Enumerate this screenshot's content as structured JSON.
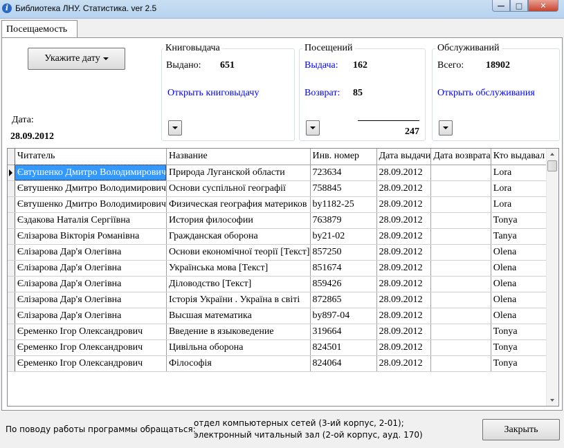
{
  "window": {
    "title": "Библиотека ЛНУ. Статистика. ver 2.5",
    "icon": "info-icon"
  },
  "tab": {
    "label": "Посещаемость"
  },
  "date_button": {
    "label": "Укажите дату"
  },
  "date": {
    "label": "Дата:",
    "value": "28.09.2012"
  },
  "books": {
    "title": "Книговыдача",
    "issued_label": "Выдано:",
    "issued_value": "651",
    "link": "Открыть книговыдачу"
  },
  "visits": {
    "title": "Посещений",
    "issue_label": "Выдача:",
    "issue_value": "162",
    "return_label": "Возврат:",
    "return_value": "85",
    "total": "247"
  },
  "service": {
    "title": "Обслуживаний",
    "total_label": "Всего:",
    "total_value": "18902",
    "link": "Открыть обслуживания"
  },
  "table": {
    "columns": [
      "Читатель",
      "Название",
      "Инв. номер",
      "Дата выдачи",
      "Дата возврата",
      "Кто выдавал"
    ],
    "rows": [
      [
        "Євтушенко Дмитро Володимирович",
        "Природа Луганской области",
        "723634",
        "28.09.2012",
        "",
        "Lora"
      ],
      [
        "Євтушенко Дмитро Володимирович",
        "Основи суспільної географії",
        "758845",
        "28.09.2012",
        "",
        "Lora"
      ],
      [
        "Євтушенко Дмитро Володимирович",
        "Физическая география материков",
        "by1182-25",
        "28.09.2012",
        "",
        "Lora"
      ],
      [
        "Єздакова Наталія Сергіївна",
        "История философии",
        "763879",
        "28.09.2012",
        "",
        "Tonya"
      ],
      [
        "Єлізарова Вікторія Романівна",
        "Гражданская оборона",
        "by21-02",
        "28.09.2012",
        "",
        "Tanya"
      ],
      [
        "Єлізарова Дар'я Олегівна",
        "Основи економічної теорії [Текст]",
        "857250",
        "28.09.2012",
        "",
        "Olena"
      ],
      [
        "Єлізарова Дар'я Олегівна",
        "Українська мова [Текст]",
        "851674",
        "28.09.2012",
        "",
        "Olena"
      ],
      [
        "Єлізарова Дар'я Олегівна",
        "Діловодство [Текст]",
        "859426",
        "28.09.2012",
        "",
        "Olena"
      ],
      [
        "Єлізарова Дар'я Олегівна",
        "Історія України . Україна в світі",
        "872865",
        "28.09.2012",
        "",
        "Olena"
      ],
      [
        "Єлізарова Дар'я Олегівна",
        "Высшая математика",
        "by897-04",
        "28.09.2012",
        "",
        "Olena"
      ],
      [
        "Єременко Ігор Олександрович",
        "Введение в языковедение",
        "319664",
        "28.09.2012",
        "",
        "Tonya"
      ],
      [
        "Єременко Ігор Олександрович",
        "Цивільна оборона",
        "824501",
        "28.09.2012",
        "",
        "Tonya"
      ],
      [
        "Єременко Ігор Олександрович",
        "Філософія",
        "824064",
        "28.09.2012",
        "",
        "Tonya"
      ]
    ]
  },
  "footer": {
    "contact_label": "По поводу работы программы обращаться:",
    "contact_line1": "отдел компьютерных сетей (3-ий корпус, 2-01);",
    "contact_line2": "электронный читальный зал (2-ой корпус, ауд. 170)",
    "close_button": "Закрыть"
  }
}
